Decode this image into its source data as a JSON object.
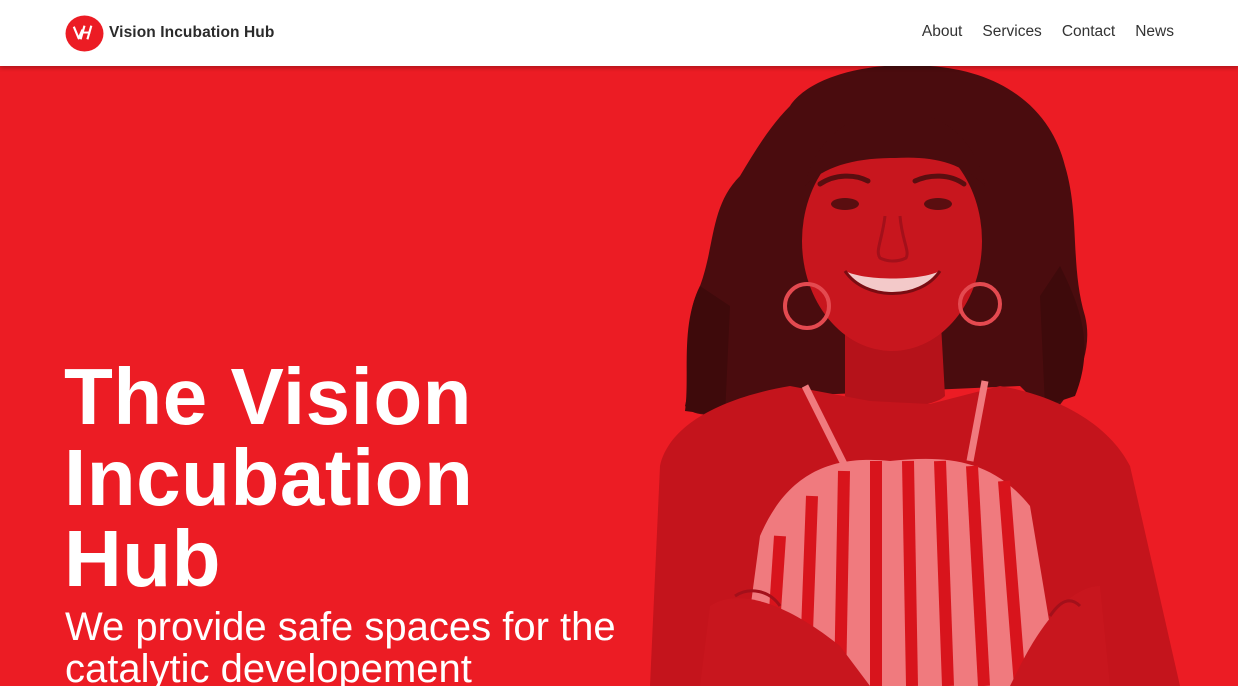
{
  "brand": {
    "name": "Vision Incubation Hub",
    "logo_icon": "vh-monogram-icon",
    "color": "#ec1c24"
  },
  "nav": {
    "items": [
      {
        "label": "About"
      },
      {
        "label": "Services"
      },
      {
        "label": "Contact"
      },
      {
        "label": "News"
      }
    ]
  },
  "hero": {
    "title": "The Vision Incubation Hub",
    "subtitle": "We provide safe spaces for the catalytic developement",
    "background_color": "#ec1c24",
    "image": "smiling-woman-photo"
  }
}
